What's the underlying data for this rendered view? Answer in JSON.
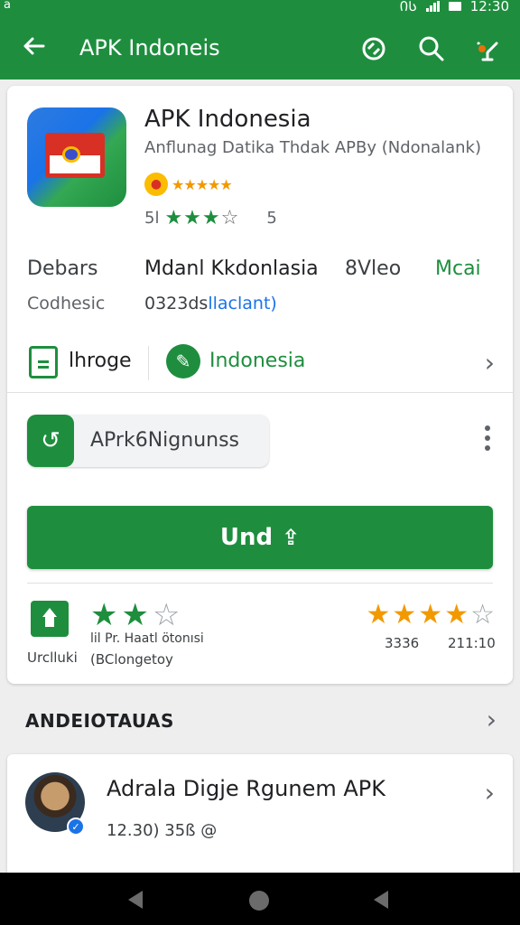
{
  "status_bar": {
    "left_glyph": "ā",
    "net": "ᲘᲡ",
    "time": "12:30"
  },
  "app_bar": {
    "title": "APK Indoneis"
  },
  "app": {
    "name": "APK Indonesia",
    "subtitle": "Anflunag Datika Thdak APBy (Ndonalank)",
    "tiny_stars": "★★★★★",
    "score": "5l",
    "stars": {
      "filled": "★★★",
      "empty": "☆"
    },
    "count": "5"
  },
  "info": {
    "label1": "Debars",
    "label2": "Mdanl Kkdonlasia",
    "label3": "8Vleo",
    "label4": "Mcai",
    "label5": "Codhesic",
    "label6_part1": "0323ds",
    "label6_part2": "llaclant)"
  },
  "chips": {
    "first": "lhroge",
    "second": "Indonesia"
  },
  "installer": {
    "label": "APrk6Nignunss"
  },
  "primary_button": {
    "label": "Und",
    "icon": "⇪"
  },
  "ratings": {
    "home_label": "Urclluki",
    "left_stars": {
      "filled": "★★",
      "empty": "☆"
    },
    "left_line1": "lil Pr. Haatl ötonısi",
    "left_line2": "(BClongetoy",
    "right_stars": {
      "filled": "★★★★",
      "empty": "☆"
    },
    "right_val1": "3336",
    "right_val2": "211:10"
  },
  "section": {
    "title": "ANDEIOTAUAS"
  },
  "review": {
    "title": "Adrala Digje Rgunem APK",
    "meta": "12.30) 35ß @"
  },
  "colors": {
    "brand_green": "#1e8e3e",
    "star_orange": "#f29900",
    "link_blue": "#1a73e8"
  }
}
